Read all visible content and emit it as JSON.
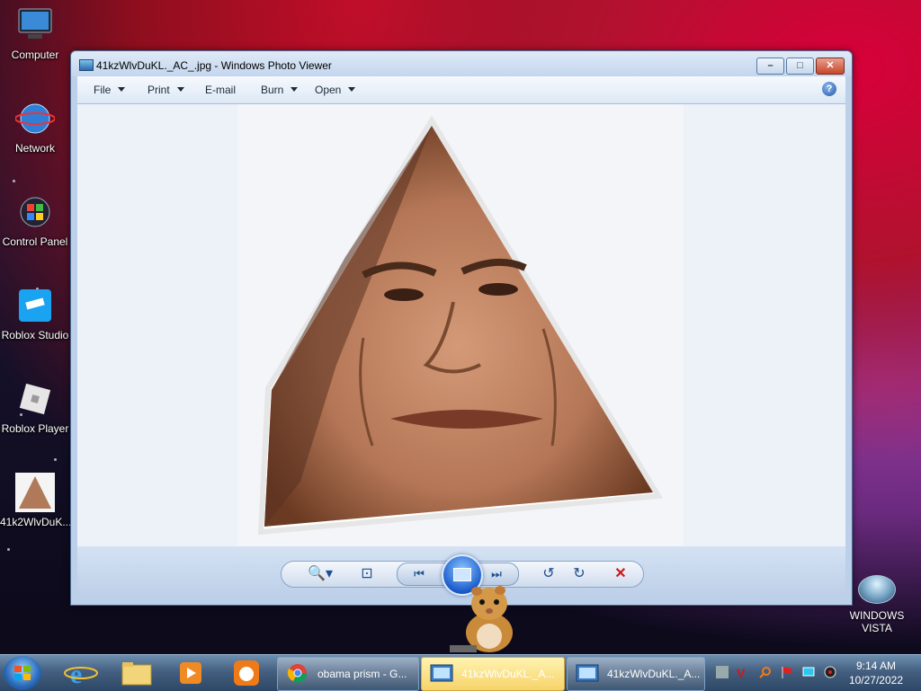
{
  "desktop": {
    "icons": [
      {
        "label": "Computer"
      },
      {
        "label": "Network"
      },
      {
        "label": "Control Panel"
      },
      {
        "label": "Roblox Studio"
      },
      {
        "label": "Roblox Player"
      },
      {
        "label": "41k2WlvDuK..."
      }
    ],
    "vista_widget": {
      "line1": "WINDOWS",
      "line2": "VISTA"
    }
  },
  "window": {
    "title": "41kzWlvDuKL._AC_.jpg - Windows Photo Viewer",
    "buttons": {
      "minimize": "–",
      "maximize": "□",
      "close": "✕"
    },
    "menu": [
      {
        "label": "File",
        "has_dropdown": true
      },
      {
        "label": "Print",
        "has_dropdown": true
      },
      {
        "label": "E-mail",
        "has_dropdown": false
      },
      {
        "label": "Burn",
        "has_dropdown": true
      },
      {
        "label": "Open",
        "has_dropdown": true
      }
    ],
    "help_label": "?",
    "controls": {
      "zoom": "🔍▾",
      "actual_size": "⊡",
      "previous": "⏮",
      "next": "⏭",
      "rotate_ccw": "↺",
      "rotate_cw": "↻",
      "delete": "✕"
    }
  },
  "taskbar": {
    "tasks": [
      {
        "label": "obama prism - G...",
        "icon": "chrome-icon",
        "active": false
      },
      {
        "label": "41kzWlvDuKL._A...",
        "icon": "photo-viewer-icon",
        "active": true
      },
      {
        "label": "41kzWlvDuKL._A...",
        "icon": "photo-viewer-icon",
        "active": false
      }
    ],
    "clock": {
      "time": "9:14 AM",
      "date": "10/27/2022"
    }
  },
  "colors": {
    "accent": "#1b5ccc",
    "close_red": "#c8462a",
    "delete_red": "#d01818"
  }
}
